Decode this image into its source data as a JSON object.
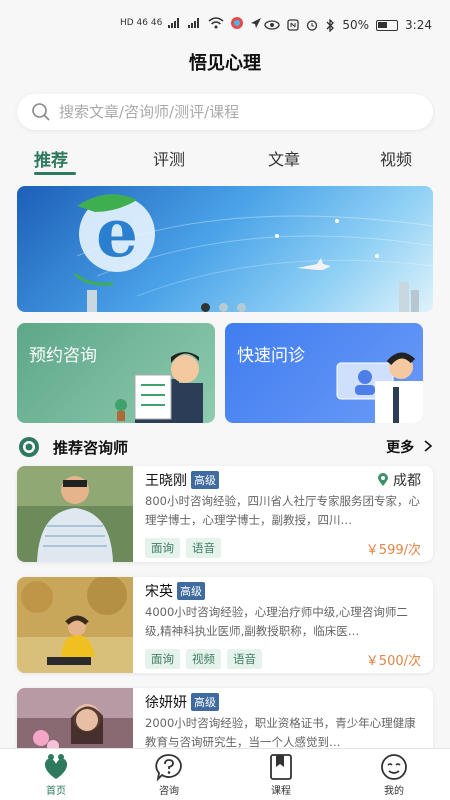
{
  "status_bar": {
    "signal_left": "HD 46 46",
    "battery": "50%",
    "time": "3:24"
  },
  "app_title": "悟见心理",
  "search": {
    "placeholder": "搜索文章/咨询师/测评/课程"
  },
  "tabs": [
    {
      "label": "推荐",
      "active": true
    },
    {
      "label": "评测",
      "active": false
    },
    {
      "label": "文章",
      "active": false
    },
    {
      "label": "视频",
      "active": false
    }
  ],
  "banner": {
    "slide_count": 3,
    "active_slide": 1
  },
  "services": [
    {
      "label": "预约咨询"
    },
    {
      "label": "快速问诊"
    }
  ],
  "section": {
    "title": "推荐咨询师",
    "more": "更多"
  },
  "counselors": [
    {
      "name": "王晓刚",
      "level": "高级",
      "city": "成都",
      "desc": "800小时咨询经验，四川省人社厅专家服务团专家，心理学博士，心理学博士，副教授，四川…",
      "tags": [
        "面询",
        "语音"
      ],
      "price": "￥599/次"
    },
    {
      "name": "宋英",
      "level": "高级",
      "city": "",
      "desc": "4000小时咨询经验，心理治疗师中级,心理咨询师二级,精神科执业医师,副教授职称，临床医…",
      "tags": [
        "面询",
        "视频",
        "语音"
      ],
      "price": "￥500/次"
    },
    {
      "name": "徐妍妍",
      "level": "高级",
      "city": "",
      "desc": "2000小时咨询经验，职业资格证书，青少年心理健康教育与咨询研究生，当一个人感觉到…",
      "tags": [],
      "price": ""
    }
  ],
  "bottom_nav": [
    {
      "label": "首页",
      "icon": "home-icon",
      "active": true
    },
    {
      "label": "咨询",
      "icon": "question-icon",
      "active": false
    },
    {
      "label": "课程",
      "icon": "book-icon",
      "active": false
    },
    {
      "label": "我的",
      "icon": "profile-icon",
      "active": false
    }
  ],
  "colors": {
    "accent": "#2f7a5e",
    "price": "#e08447",
    "badge": "#3f6ba0"
  }
}
